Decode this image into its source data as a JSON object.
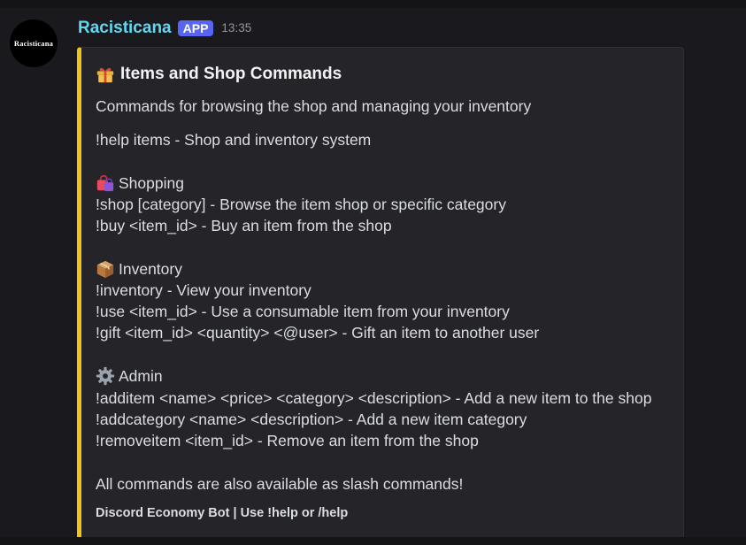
{
  "message": {
    "avatar_text": "Racisticana",
    "username": "Racisticana",
    "badge": "APP",
    "timestamp": "13:35"
  },
  "embed": {
    "accent_color": "#f0c419",
    "title": "Items and Shop Commands",
    "title_icon": "gift-icon",
    "description": "Commands for browsing the shop and managing your inventory",
    "help_line": "!help items - Shop and inventory system",
    "sections": [
      {
        "icon": "shopping-bags-icon",
        "heading": "Shopping",
        "lines": [
          "!shop [category] - Browse the item shop or specific category",
          "!buy <item_id> - Buy an item from the shop"
        ]
      },
      {
        "icon": "package-icon",
        "heading": "Inventory",
        "lines": [
          "!inventory - View your inventory",
          "!use <item_id> - Use a consumable item from your inventory",
          "!gift <item_id> <quantity> <@user> - Gift an item to another user"
        ]
      },
      {
        "icon": "gear-icon",
        "heading": "Admin",
        "lines": [
          "!additem <name> <price> <category> <description> - Add a new item to the shop",
          "!addcategory <name> <description> - Add a new item category",
          "!removeitem <item_id> - Remove an item from the shop"
        ]
      }
    ],
    "note": "All commands are also available as slash commands!",
    "footer": "Discord Economy Bot | Use !help or /help"
  }
}
